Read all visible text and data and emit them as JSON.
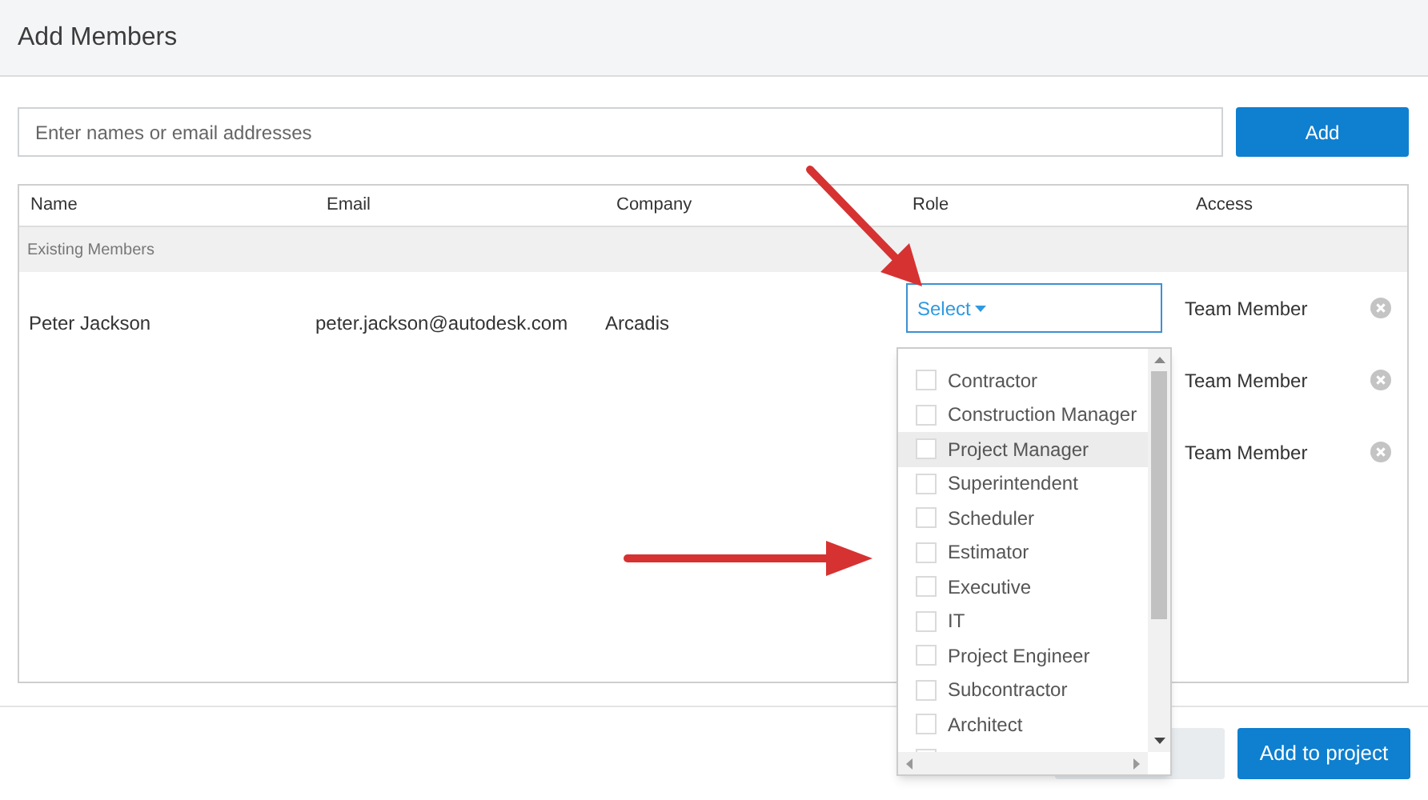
{
  "dialog": {
    "title": "Add Members"
  },
  "invite": {
    "placeholder": "Enter names or email addresses",
    "button": "Add"
  },
  "table": {
    "columns": [
      "Name",
      "Email",
      "Company",
      "Role",
      "Access"
    ],
    "group": "Existing Members",
    "rows": [
      {
        "name": "Peter Jackson",
        "email": "peter.jackson@autodesk.com",
        "company": "Arcadis",
        "role": "Select",
        "access": "Team Member"
      },
      {
        "access": "Team Member"
      },
      {
        "access": "Team Member"
      }
    ]
  },
  "role_menu": {
    "expanded": true,
    "options": [
      {
        "label": "Contractor",
        "checked": false,
        "highlighted": false
      },
      {
        "label": "Construction Manager",
        "checked": false,
        "highlighted": false
      },
      {
        "label": "Project Manager",
        "checked": false,
        "highlighted": true
      },
      {
        "label": "Superintendent",
        "checked": false,
        "highlighted": false
      },
      {
        "label": "Scheduler",
        "checked": false,
        "highlighted": false
      },
      {
        "label": "Estimator",
        "checked": false,
        "highlighted": false
      },
      {
        "label": "Executive",
        "checked": false,
        "highlighted": false
      },
      {
        "label": "IT",
        "checked": false,
        "highlighted": false
      },
      {
        "label": "Project Engineer",
        "checked": false,
        "highlighted": false
      },
      {
        "label": "Subcontractor",
        "checked": false,
        "highlighted": false
      },
      {
        "label": "Architect",
        "checked": false,
        "highlighted": false
      }
    ]
  },
  "footer": {
    "primary": "Add to project"
  }
}
